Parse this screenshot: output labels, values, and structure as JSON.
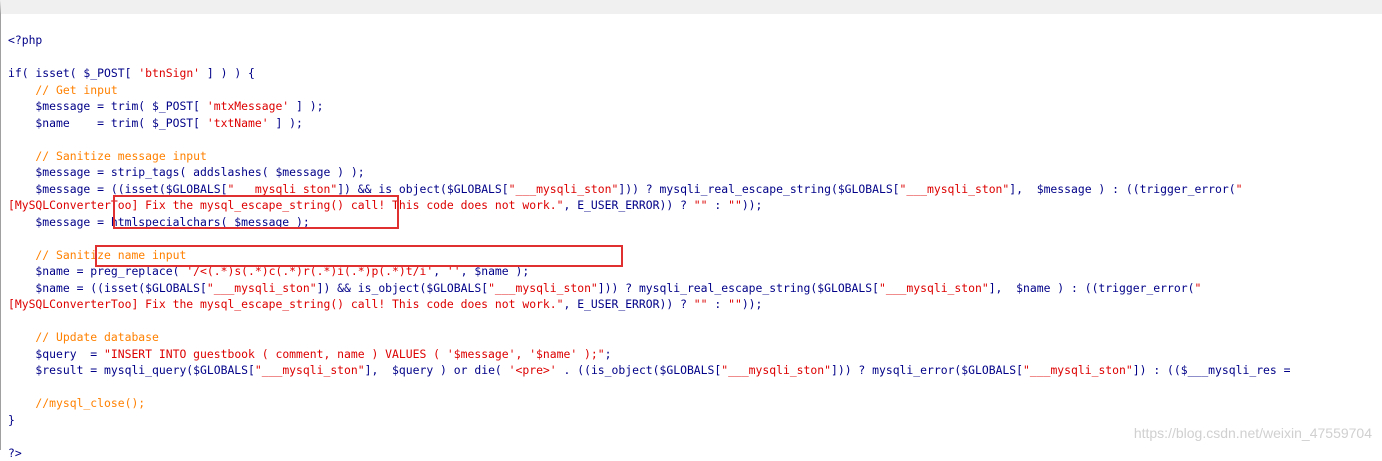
{
  "code_lines": [
    [
      {
        "t": "<?php",
        "k": "n"
      }
    ],
    [],
    [
      {
        "t": "if( isset( $_POST[ ",
        "k": "n"
      },
      {
        "t": "'btnSign'",
        "k": "s"
      },
      {
        "t": " ] ) ) {",
        "k": "n"
      }
    ],
    [
      {
        "t": "    // Get input",
        "k": "c"
      }
    ],
    [
      {
        "t": "    $message = trim( $_POST[ ",
        "k": "n"
      },
      {
        "t": "'mtxMessage'",
        "k": "s"
      },
      {
        "t": " ] );",
        "k": "n"
      }
    ],
    [
      {
        "t": "    $name    = trim( $_POST[ ",
        "k": "n"
      },
      {
        "t": "'txtName'",
        "k": "s"
      },
      {
        "t": " ] );",
        "k": "n"
      }
    ],
    [],
    [
      {
        "t": "    // Sanitize message input",
        "k": "c"
      }
    ],
    [
      {
        "t": "    $message = strip_tags( addslashes( $message ) );",
        "k": "n"
      }
    ],
    [
      {
        "t": "    $message = ((isset($GLOBALS[",
        "k": "n"
      },
      {
        "t": "\"___mysqli_ston\"",
        "k": "s"
      },
      {
        "t": "]) && is_object($GLOBALS[",
        "k": "n"
      },
      {
        "t": "\"___mysqli_ston\"",
        "k": "s"
      },
      {
        "t": "])) ? mysqli_real_escape_string($GLOBALS[",
        "k": "n"
      },
      {
        "t": "\"___mysqli_ston\"",
        "k": "s"
      },
      {
        "t": "],  $message ) : ((trigger_error(",
        "k": "n"
      },
      {
        "t": "\"",
        "k": "s"
      }
    ],
    [
      {
        "t": "[MySQLConverterToo] Fix the mysql_escape_string() call! This code does not work.\"",
        "k": "s"
      },
      {
        "t": ", E_USER_ERROR)) ? ",
        "k": "n"
      },
      {
        "t": "\"\"",
        "k": "s"
      },
      {
        "t": " : ",
        "k": "n"
      },
      {
        "t": "\"\"",
        "k": "s"
      },
      {
        "t": "));",
        "k": "n"
      }
    ],
    [
      {
        "t": "    $message = htmlspecialchars( $message );",
        "k": "n"
      }
    ],
    [],
    [
      {
        "t": "    // Sanitize name input",
        "k": "c"
      }
    ],
    [
      {
        "t": "    $name = preg_replace( ",
        "k": "n"
      },
      {
        "t": "'/<(.*)s(.*)c(.*)r(.*)i(.*)p(.*)t/i'",
        "k": "s"
      },
      {
        "t": ", ",
        "k": "n"
      },
      {
        "t": "''",
        "k": "s"
      },
      {
        "t": ", $name );",
        "k": "n"
      }
    ],
    [
      {
        "t": "    $name = ((isset($GLOBALS[",
        "k": "n"
      },
      {
        "t": "\"___mysqli_ston\"",
        "k": "s"
      },
      {
        "t": "]) && is_object($GLOBALS[",
        "k": "n"
      },
      {
        "t": "\"___mysqli_ston\"",
        "k": "s"
      },
      {
        "t": "])) ? mysqli_real_escape_string($GLOBALS[",
        "k": "n"
      },
      {
        "t": "\"___mysqli_ston\"",
        "k": "s"
      },
      {
        "t": "],  $name ) : ((trigger_error(",
        "k": "n"
      },
      {
        "t": "\"",
        "k": "s"
      }
    ],
    [
      {
        "t": "[MySQLConverterToo] Fix the mysql_escape_string() call! This code does not work.\"",
        "k": "s"
      },
      {
        "t": ", E_USER_ERROR)) ? ",
        "k": "n"
      },
      {
        "t": "\"\"",
        "k": "s"
      },
      {
        "t": " : ",
        "k": "n"
      },
      {
        "t": "\"\"",
        "k": "s"
      },
      {
        "t": "));",
        "k": "n"
      }
    ],
    [],
    [
      {
        "t": "    // Update database",
        "k": "c"
      }
    ],
    [
      {
        "t": "    $query  = ",
        "k": "n"
      },
      {
        "t": "\"INSERT INTO guestbook ( comment, name ) VALUES ( '$message', '$name' );\"",
        "k": "s"
      },
      {
        "t": ";",
        "k": "n"
      }
    ],
    [
      {
        "t": "    $result = mysqli_query($GLOBALS[",
        "k": "n"
      },
      {
        "t": "\"___mysqli_ston\"",
        "k": "s"
      },
      {
        "t": "],  $query ) or die( ",
        "k": "n"
      },
      {
        "t": "'<pre>'",
        "k": "s"
      },
      {
        "t": " . ((is_object($GLOBALS[",
        "k": "n"
      },
      {
        "t": "\"___mysqli_ston\"",
        "k": "s"
      },
      {
        "t": "])) ? mysqli_error($GLOBALS[",
        "k": "n"
      },
      {
        "t": "\"___mysqli_ston\"",
        "k": "s"
      },
      {
        "t": "]) : (($___mysqli_res =",
        "k": "n"
      }
    ],
    [],
    [
      {
        "t": "    //mysql_close();",
        "k": "c"
      }
    ],
    [
      {
        "t": "}",
        "k": "n"
      }
    ],
    [],
    [
      {
        "t": "?>",
        "k": "n"
      }
    ]
  ],
  "watermark": "https://blog.csdn.net/weixin_47559704",
  "colors": {
    "default": "#000088",
    "string": "#dd0000",
    "comment": "#ff8000",
    "highlight_box": "#e03030"
  }
}
